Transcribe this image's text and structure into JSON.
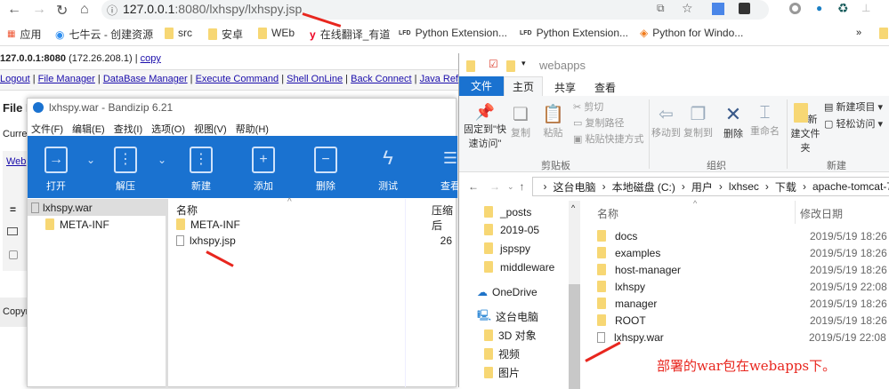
{
  "browser": {
    "url_host": "127.0.0.1",
    "url_rest": ":8080/lxhspy/lxhspy.jsp",
    "bookmarks": [
      "应用",
      "七牛云 - 创建资源",
      "src",
      "安卓",
      "WEb",
      "在线翻译_有道",
      "Python Extension...",
      "Python Extension...",
      "Python for Windo..."
    ],
    "more": "»"
  },
  "page": {
    "host": "127.0.0.1:8080",
    "ip": "(172.26.208.1) |",
    "copy": "copy",
    "nav": [
      "Logout",
      "File Manager",
      "DataBase Manager",
      "Execute Command",
      "Shell OnLine",
      "Back Connect",
      "Java Reflect"
    ],
    "file_heading": "File M",
    "current": "Curre",
    "web": "Web",
    "copyright": "Copyr"
  },
  "bandizip": {
    "title": "lxhspy.war - Bandizip 6.21",
    "menu": [
      "文件(F)",
      "编辑(E)",
      "查找(I)",
      "选项(O)",
      "视图(V)",
      "帮助(H)"
    ],
    "toolbar": [
      "打开",
      "解压",
      "新建",
      "添加",
      "删除",
      "测试",
      "查看"
    ],
    "tree": [
      "lxhspy.war",
      "META-INF"
    ],
    "col_name": "名称",
    "col_size": "压缩后",
    "files": [
      {
        "name": "META-INF",
        "type": "folder",
        "size": ""
      },
      {
        "name": "lxhspy.jsp",
        "type": "file",
        "size": "26"
      }
    ]
  },
  "explorer": {
    "title": "webapps",
    "tabs": [
      "文件",
      "主页",
      "共享",
      "查看"
    ],
    "ribbon": {
      "pin": "固定到\"快速访问\"",
      "copy": "复制",
      "paste": "粘贴",
      "cut": "剪切",
      "copy_path": "复制路径",
      "paste_shortcut": "粘贴快捷方式",
      "clipboard": "剪贴板",
      "move_to": "移动到",
      "copy_to": "复制到",
      "delete": "删除",
      "rename": "重命名",
      "organize": "组织",
      "new_folder": "新建文件夹",
      "new_item": "新建项目 ▾",
      "easy_access": "轻松访问 ▾",
      "new": "新建"
    },
    "breadcrumb": [
      "这台电脑",
      "本地磁盘 (C:)",
      "用户",
      "lxhsec",
      "下载",
      "apache-tomcat-7"
    ],
    "nav_items": [
      "_posts",
      "2019-05",
      "jspspy",
      "middleware",
      "OneDrive",
      "这台电脑",
      "3D 对象",
      "视频",
      "图片"
    ],
    "col_name": "名称",
    "col_date": "修改日期",
    "files": [
      {
        "name": "docs",
        "date": "2019/5/19 18:26",
        "type": "folder"
      },
      {
        "name": "examples",
        "date": "2019/5/19 18:26",
        "type": "folder"
      },
      {
        "name": "host-manager",
        "date": "2019/5/19 18:26",
        "type": "folder"
      },
      {
        "name": "lxhspy",
        "date": "2019/5/19 22:08",
        "type": "folder"
      },
      {
        "name": "manager",
        "date": "2019/5/19 18:26",
        "type": "folder"
      },
      {
        "name": "ROOT",
        "date": "2019/5/19 18:26",
        "type": "folder"
      },
      {
        "name": "lxhspy.war",
        "date": "2019/5/19 22:08",
        "type": "file"
      }
    ]
  },
  "annotation": "部署的war包在webapps下。",
  "colors": {
    "accent": "#1a72d0",
    "annotation": "#e8261e"
  }
}
